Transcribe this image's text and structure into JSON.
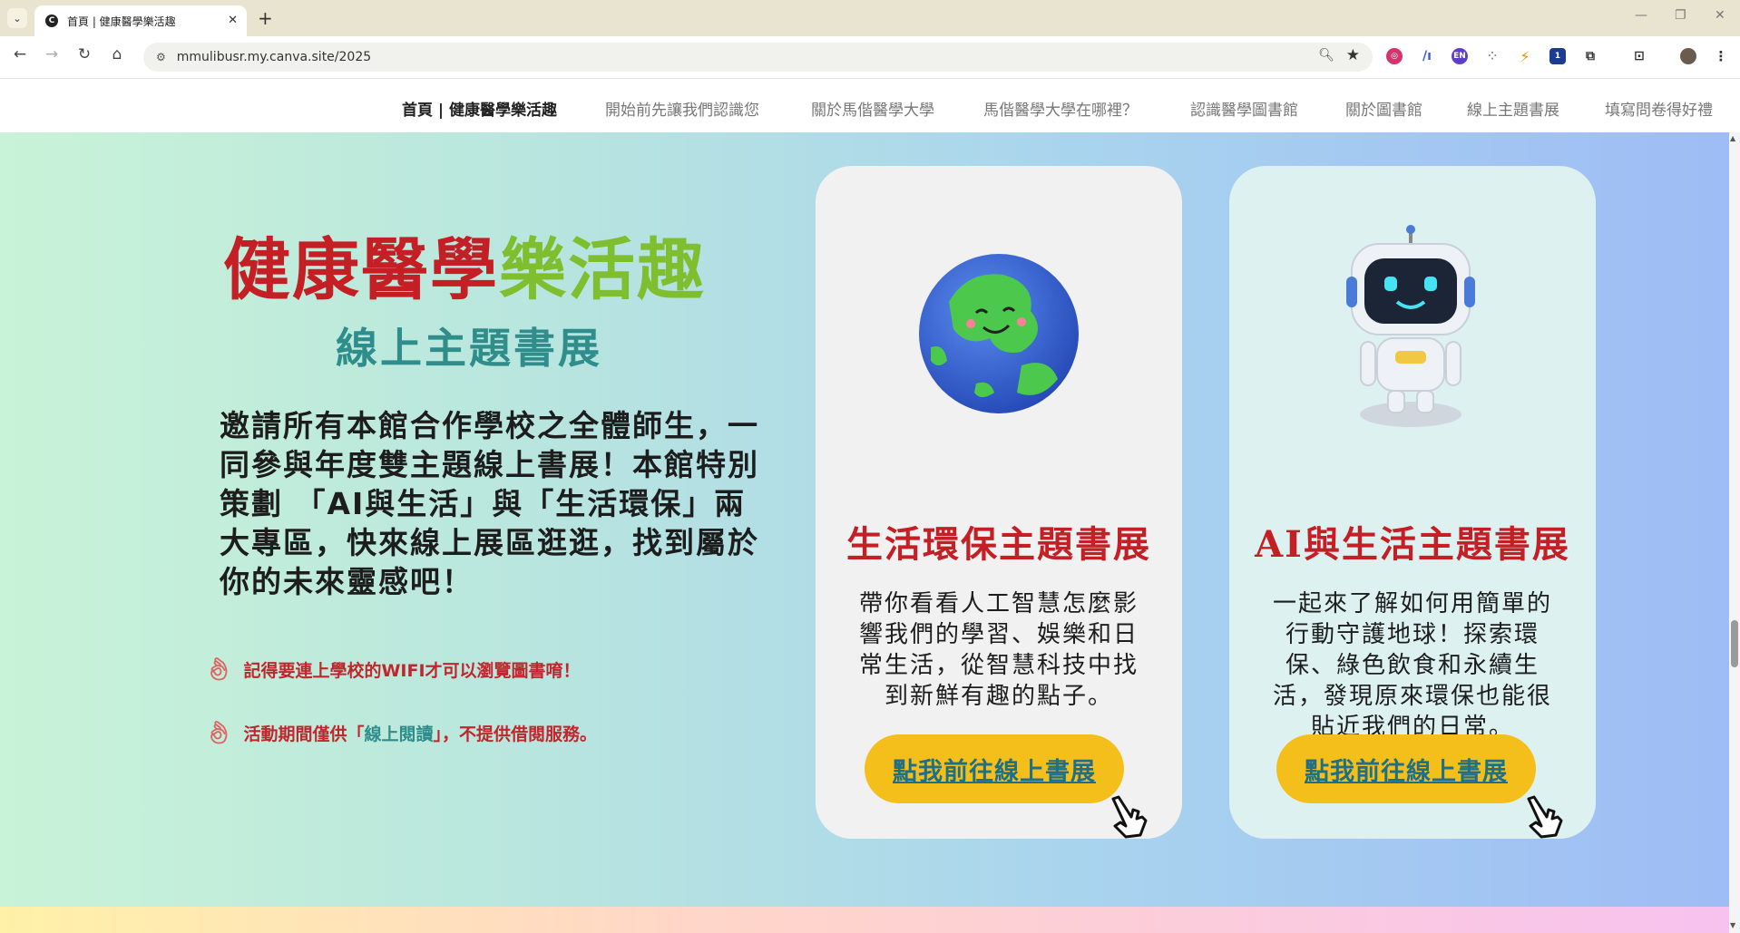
{
  "browser": {
    "tab_title": "首頁 | 健康醫學樂活趣",
    "url": "mmulibusr.my.canva.site/2025",
    "new_tab_label": "+",
    "tab_close": "✕"
  },
  "site_nav": {
    "items": [
      {
        "label": "首頁 | 健康醫學樂活趣",
        "active": true
      },
      {
        "label": "開始前先讓我們認識您"
      },
      {
        "label": "關於馬偕醫學大學"
      },
      {
        "label": "馬偕醫學大學在哪裡？"
      },
      {
        "label": "認識醫學圖書館"
      },
      {
        "label": "關於圖書館"
      },
      {
        "label": "線上主題書展"
      },
      {
        "label": "填寫問卷得好禮"
      }
    ]
  },
  "hero": {
    "title_part1": "健康醫學",
    "title_part2": "樂活趣",
    "subtitle": "線上主題書展",
    "description": "邀請所有本館合作學校之全體師生，一同參與年度雙主題線上書展！本館特別策劃 「AI與生活」與「生活環保」兩大專區，快來線上展區逛逛，找到屬於你的未來靈感吧！",
    "note1": "記得要連上學校的WIFI才可以瀏覽圖書唷！",
    "note2_a": "活動期間僅供「",
    "note2_b": "線上閱讀",
    "note2_c": "」，不提供借閱服務。"
  },
  "cards": {
    "left": {
      "title": "生活環保主題書展",
      "body": "帶你看看人工智慧怎麼影響我們的學習、娛樂和日常生活，從智慧科技中找到新鮮有趣的點子。",
      "cta": "點我前往線上書展"
    },
    "right": {
      "title": "AI與生活主題書展",
      "body": "一起來了解如何用簡單的行動守護地球！探索環保、綠色飲食和永續生活，發現原來環保也能很貼近我們的日常。",
      "cta": "點我前往線上書展"
    }
  },
  "colors": {
    "title_red": "#c51f26",
    "title_green": "#7fbf2f",
    "teal": "#2f8d8b",
    "cta_yellow": "#f5bf1b",
    "cta_text": "#1f6f86"
  }
}
